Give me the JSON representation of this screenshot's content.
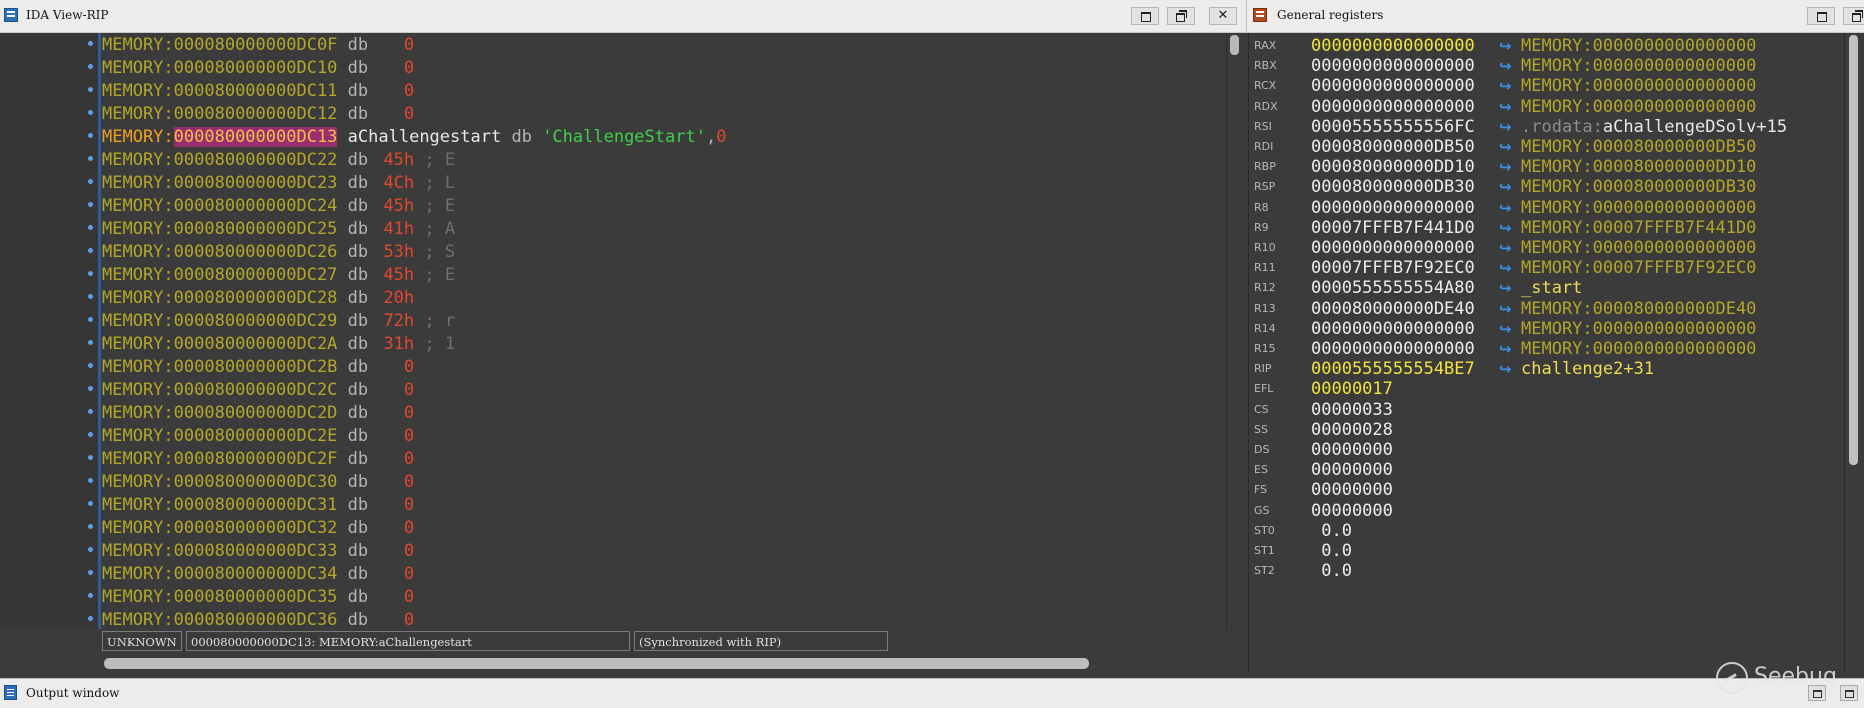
{
  "ida_view": {
    "title": "IDA View-RIP",
    "rows": [
      {
        "seg": "MEMORY:",
        "addr": "000080000000DC0F",
        "op": "db",
        "val": "0",
        "cmt": ""
      },
      {
        "seg": "MEMORY:",
        "addr": "000080000000DC10",
        "op": "db",
        "val": "0",
        "cmt": ""
      },
      {
        "seg": "MEMORY:",
        "addr": "000080000000DC11",
        "op": "db",
        "val": "0",
        "cmt": ""
      },
      {
        "seg": "MEMORY:",
        "addr": "000080000000DC12",
        "op": "db",
        "val": "0",
        "cmt": ""
      },
      {
        "seg": "MEMORY:",
        "addr": "000080000000DC13",
        "name": "aChallengestart",
        "op": "db",
        "str": "'ChallengeStart'",
        "tail": "0",
        "current": true
      },
      {
        "seg": "MEMORY:",
        "addr": "000080000000DC22",
        "op": "db",
        "val": "45h",
        "cmt": "; E"
      },
      {
        "seg": "MEMORY:",
        "addr": "000080000000DC23",
        "op": "db",
        "val": "4Ch",
        "cmt": "; L"
      },
      {
        "seg": "MEMORY:",
        "addr": "000080000000DC24",
        "op": "db",
        "val": "45h",
        "cmt": "; E"
      },
      {
        "seg": "MEMORY:",
        "addr": "000080000000DC25",
        "op": "db",
        "val": "41h",
        "cmt": "; A"
      },
      {
        "seg": "MEMORY:",
        "addr": "000080000000DC26",
        "op": "db",
        "val": "53h",
        "cmt": "; S"
      },
      {
        "seg": "MEMORY:",
        "addr": "000080000000DC27",
        "op": "db",
        "val": "45h",
        "cmt": "; E"
      },
      {
        "seg": "MEMORY:",
        "addr": "000080000000DC28",
        "op": "db",
        "val": "20h",
        "cmt": ""
      },
      {
        "seg": "MEMORY:",
        "addr": "000080000000DC29",
        "op": "db",
        "val": "72h",
        "cmt": "; r"
      },
      {
        "seg": "MEMORY:",
        "addr": "000080000000DC2A",
        "op": "db",
        "val": "31h",
        "cmt": "; 1"
      },
      {
        "seg": "MEMORY:",
        "addr": "000080000000DC2B",
        "op": "db",
        "val": "0",
        "cmt": ""
      },
      {
        "seg": "MEMORY:",
        "addr": "000080000000DC2C",
        "op": "db",
        "val": "0",
        "cmt": ""
      },
      {
        "seg": "MEMORY:",
        "addr": "000080000000DC2D",
        "op": "db",
        "val": "0",
        "cmt": ""
      },
      {
        "seg": "MEMORY:",
        "addr": "000080000000DC2E",
        "op": "db",
        "val": "0",
        "cmt": ""
      },
      {
        "seg": "MEMORY:",
        "addr": "000080000000DC2F",
        "op": "db",
        "val": "0",
        "cmt": ""
      },
      {
        "seg": "MEMORY:",
        "addr": "000080000000DC30",
        "op": "db",
        "val": "0",
        "cmt": ""
      },
      {
        "seg": "MEMORY:",
        "addr": "000080000000DC31",
        "op": "db",
        "val": "0",
        "cmt": ""
      },
      {
        "seg": "MEMORY:",
        "addr": "000080000000DC32",
        "op": "db",
        "val": "0",
        "cmt": ""
      },
      {
        "seg": "MEMORY:",
        "addr": "000080000000DC33",
        "op": "db",
        "val": "0",
        "cmt": ""
      },
      {
        "seg": "MEMORY:",
        "addr": "000080000000DC34",
        "op": "db",
        "val": "0",
        "cmt": ""
      },
      {
        "seg": "MEMORY:",
        "addr": "000080000000DC35",
        "op": "db",
        "val": "0",
        "cmt": ""
      },
      {
        "seg": "MEMORY:",
        "addr": "000080000000DC36",
        "op": "db",
        "val": "0",
        "cmt": ""
      }
    ],
    "status": {
      "mode": "UNKNOWN",
      "location": "000080000000DC13: MEMORY:aChallengestart",
      "sync": "(Synchronized with RIP)"
    }
  },
  "registers": {
    "title": "General registers",
    "items": [
      {
        "name": "RAX",
        "value": "0000000000000000",
        "changed": true,
        "tseg": "MEMORY:",
        "tname": "0000000000000000"
      },
      {
        "name": "RBX",
        "value": "0000000000000000",
        "changed": false,
        "tseg": "MEMORY:",
        "tname": "0000000000000000"
      },
      {
        "name": "RCX",
        "value": "0000000000000000",
        "changed": false,
        "tseg": "MEMORY:",
        "tname": "0000000000000000"
      },
      {
        "name": "RDX",
        "value": "0000000000000000",
        "changed": false,
        "tseg": "MEMORY:",
        "tname": "0000000000000000"
      },
      {
        "name": "RSI",
        "value": "00005555555556FC",
        "changed": false,
        "trod": ".rodata:",
        "tsym": "aChallengeDSolv+15"
      },
      {
        "name": "RDI",
        "value": "000080000000DB50",
        "changed": false,
        "tseg": "MEMORY:",
        "tname": "000080000000DB50"
      },
      {
        "name": "RBP",
        "value": "000080000000DD10",
        "changed": false,
        "tseg": "MEMORY:",
        "tname": "000080000000DD10"
      },
      {
        "name": "RSP",
        "value": "000080000000DB30",
        "changed": false,
        "tseg": "MEMORY:",
        "tname": "000080000000DB30"
      },
      {
        "name": "R8",
        "value": "0000000000000000",
        "changed": false,
        "tseg": "MEMORY:",
        "tname": "0000000000000000"
      },
      {
        "name": "R9",
        "value": "00007FFFB7F441D0",
        "changed": false,
        "tseg": "MEMORY:",
        "tname": "00007FFFB7F441D0"
      },
      {
        "name": "R10",
        "value": "0000000000000000",
        "changed": false,
        "tseg": "MEMORY:",
        "tname": "0000000000000000"
      },
      {
        "name": "R11",
        "value": "00007FFFB7F92EC0",
        "changed": false,
        "tseg": "MEMORY:",
        "tname": "00007FFFB7F92EC0"
      },
      {
        "name": "R12",
        "value": "0000555555554A80",
        "changed": false,
        "tsymY": "_start"
      },
      {
        "name": "R13",
        "value": "000080000000DE40",
        "changed": false,
        "tseg": "MEMORY:",
        "tname": "000080000000DE40"
      },
      {
        "name": "R14",
        "value": "0000000000000000",
        "changed": false,
        "tseg": "MEMORY:",
        "tname": "0000000000000000"
      },
      {
        "name": "R15",
        "value": "0000000000000000",
        "changed": false,
        "tseg": "MEMORY:",
        "tname": "0000000000000000"
      },
      {
        "name": "RIP",
        "value": "0000555555554BE7",
        "changed": true,
        "tsymY": "challenge2+31"
      },
      {
        "name": "EFL",
        "value": "00000017",
        "changed": true
      },
      {
        "name": "CS",
        "value": "00000033",
        "changed": false
      },
      {
        "name": "SS",
        "value": "00000028",
        "changed": false
      },
      {
        "name": "DS",
        "value": "00000000",
        "changed": false
      },
      {
        "name": "ES",
        "value": "00000000",
        "changed": false
      },
      {
        "name": "FS",
        "value": "00000000",
        "changed": false
      },
      {
        "name": "GS",
        "value": "00000000",
        "changed": false
      },
      {
        "name": "ST0",
        "value": " 0.0",
        "changed": false
      },
      {
        "name": "ST1",
        "value": " 0.0",
        "changed": false
      },
      {
        "name": "ST2",
        "value": " 0.0",
        "changed": false
      }
    ]
  },
  "output": {
    "title": "Output window"
  },
  "watermark": {
    "text": "Seebug"
  },
  "icons": {
    "ida_view": "disassembly-icon",
    "registers": "registers-icon",
    "output": "output-icon",
    "arrow": "pointer-arrow-icon"
  }
}
